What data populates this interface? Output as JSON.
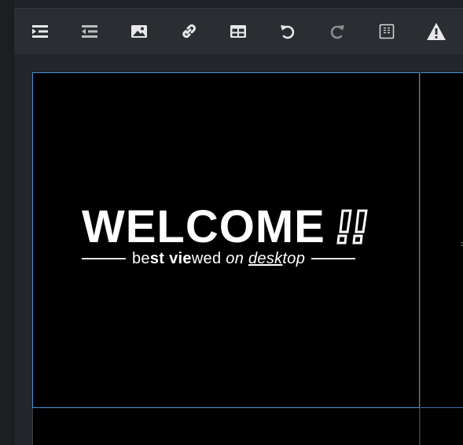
{
  "toolbar": {
    "buttons": [
      {
        "name": "indent",
        "icon": "indent-icon"
      },
      {
        "name": "outdent",
        "icon": "outdent-icon"
      },
      {
        "name": "insert-image",
        "icon": "image-icon"
      },
      {
        "name": "insert-link",
        "icon": "link-icon"
      },
      {
        "name": "insert-table",
        "icon": "table-icon"
      },
      {
        "name": "undo",
        "icon": "undo-icon"
      },
      {
        "name": "redo",
        "icon": "redo-icon"
      },
      {
        "name": "source",
        "icon": "source-icon"
      },
      {
        "name": "warning",
        "icon": "warning-icon"
      }
    ]
  },
  "banner": {
    "heading": "WELCOME",
    "tagline": {
      "part1": "be",
      "part2": "st ",
      "part3": "vie",
      "part4": "wed ",
      "part5": "on ",
      "part6": "desk",
      "part7": "top"
    }
  },
  "colors": {
    "selection_border": "#4a90d9",
    "toolbar_bg": "#2a2d31",
    "icon_color": "#d9d9d9"
  }
}
